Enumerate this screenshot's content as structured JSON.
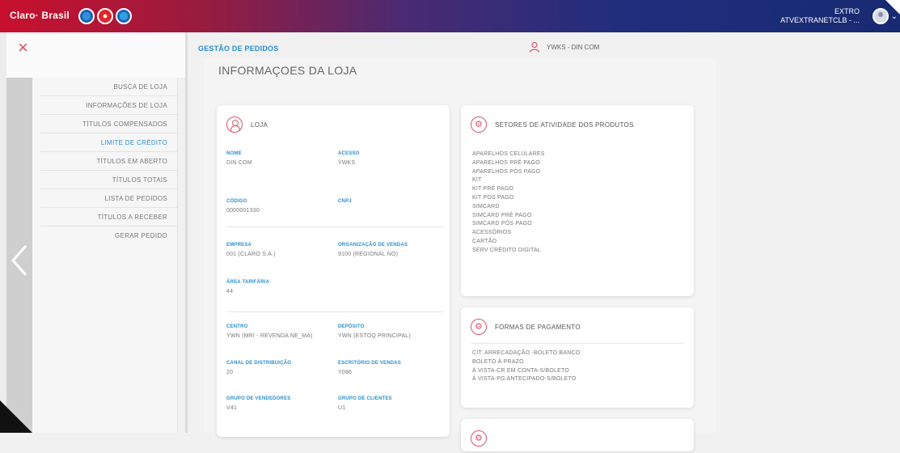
{
  "topbar": {
    "brand": "Claro· Brasil",
    "user_line1": "EXTRO",
    "user_line2": "ATVEXTRANETCLB - ...",
    "flags": [
      "embratel-icon",
      "claro-icon",
      "net-icon"
    ]
  },
  "menu": {
    "items": [
      {
        "label": "BUSCA DE LOJA",
        "active": false
      },
      {
        "label": "INFORMAÇÕES DE LOJA",
        "active": false
      },
      {
        "label": "TÍTULOS COMPENSADOS",
        "active": false
      },
      {
        "label": "LIMITE DE CRÉDITO",
        "active": true
      },
      {
        "label": "TÍTULOS EM ABERTO",
        "active": false
      },
      {
        "label": "TÍTULOS TOTAIS",
        "active": false
      },
      {
        "label": "LISTA DE PEDIDOS",
        "active": false
      },
      {
        "label": "TÍTULOS A RECEBER",
        "active": false
      },
      {
        "label": "GERAR PEDIDO",
        "active": false
      }
    ]
  },
  "header": {
    "page_title": "GESTÃO DE PEDIDOS",
    "user": "YWKS - DIN COM"
  },
  "main": {
    "section_title": "INFORMAÇOES DA LOJA"
  },
  "loja": {
    "title": "LOJA",
    "fields": {
      "nome_label": "NOME",
      "nome_value": "DIN COM",
      "acesso_label": "ACESSO",
      "acesso_value": "YWKS",
      "codigo_label": "CÓDIGO",
      "codigo_value": "0000001330",
      "cnpj_label": "CNPJ",
      "cnpj_value": "",
      "empresa_label": "EMPRESA",
      "empresa_value": "001 (CLARO S.A.)",
      "org_label": "ORGANIZAÇÃO DE VENDAS",
      "org_value": "9100 (REGIONAL NO)",
      "area_label": "ÁREA TARIFÁRIA",
      "area_value": "44",
      "centro_label": "CENTRO",
      "centro_value": "YWN (MRI - REVENDA NE_MA)",
      "deposito_label": "DEPÓSITO",
      "deposito_value": "YWN (ESTOQ PRINCIPAL)",
      "canal_label": "CANAL DE DISTRIBUIÇÃO",
      "canal_value": "20",
      "escritorio_label": "ESCRITÓRIO DE VENDAS",
      "escritorio_value": "Y086",
      "grupo_vend_label": "GRUPO DE VENDEDORES",
      "grupo_vend_value": "V41",
      "grupo_cli_label": "GRUPO DE CLIENTES",
      "grupo_cli_value": "U1"
    }
  },
  "setores": {
    "title": "SETORES DE ATIVIDADE DOS PRODUTOS",
    "items": [
      "APARELHOS CELULARES",
      "APARELHOS PRÉ PAGO",
      "APARELHOS PÓS PAGO",
      "KIT",
      "KIT PRÉ PAGO",
      "KIT PÓS PAGO",
      "SIMCARD",
      "SIMCARD PRÉ PAGO",
      "SIMCARD PÓS PAGO",
      "ACESSÓRIOS",
      "CARTÃO",
      "SERV CRÉDITO DIGITAL"
    ]
  },
  "pagamento": {
    "title": "FORMAS DE PAGAMENTO",
    "items": [
      "CIT: ARRECADAÇÃO -BOLETO BANCO",
      "BOLETO À PRAZO",
      "À VISTA-CR EM CONTA-S/BOLETO",
      "À VISTA-PG ANTECIPADO-S/BOLETO"
    ]
  }
}
